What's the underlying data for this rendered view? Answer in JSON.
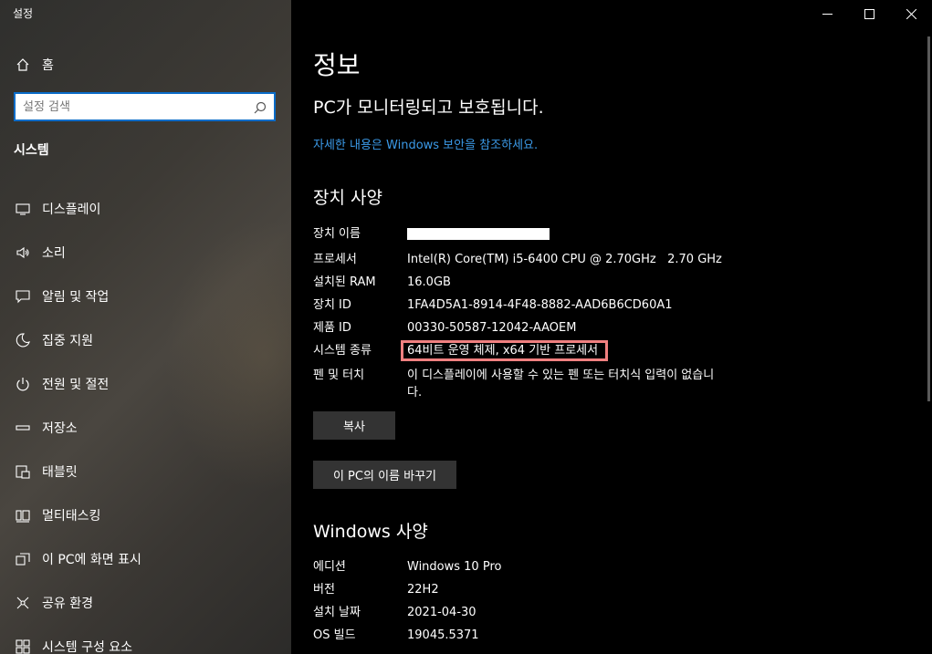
{
  "app": {
    "title": "설정"
  },
  "sidebar": {
    "home_label": "홈",
    "search_placeholder": "설정 검색",
    "section_title": "시스템",
    "items": [
      {
        "label": "디스플레이",
        "icon": "display-icon"
      },
      {
        "label": "소리",
        "icon": "speaker-icon"
      },
      {
        "label": "알림 및 작업",
        "icon": "notification-icon"
      },
      {
        "label": "집중 지원",
        "icon": "moon-icon"
      },
      {
        "label": "전원 및 절전",
        "icon": "power-icon"
      },
      {
        "label": "저장소",
        "icon": "storage-icon"
      },
      {
        "label": "태블릿",
        "icon": "tablet-icon"
      },
      {
        "label": "멀티태스킹",
        "icon": "multitasking-icon"
      },
      {
        "label": "이 PC에 화면 표시",
        "icon": "project-icon"
      },
      {
        "label": "공유 환경",
        "icon": "share-icon"
      },
      {
        "label": "시스템 구성 요소",
        "icon": "components-icon"
      }
    ]
  },
  "main": {
    "page_title": "정보",
    "protect_text": "PC가 모니터링되고 보호됩니다.",
    "security_link": "자세한 내용은 Windows 보안을 참조하세요.",
    "device_specs_title": "장치 사양",
    "device_specs": [
      {
        "key": "장치 이름",
        "value": ""
      },
      {
        "key": "프로세서",
        "value": "Intel(R) Core(TM) i5-6400 CPU @ 2.70GHz   2.70 GHz"
      },
      {
        "key": "설치된 RAM",
        "value": "16.0GB"
      },
      {
        "key": "장치 ID",
        "value": "1FA4D5A1-8914-4F48-8882-AAD6B6CD60A1"
      },
      {
        "key": "제품 ID",
        "value": "00330-50587-12042-AAOEM"
      },
      {
        "key": "시스템 종류",
        "value": "64비트 운영 체제, x64 기반 프로세서"
      },
      {
        "key": "펜 및 터치",
        "value": "이 디스플레이에 사용할 수 있는 펜 또는 터치식 입력이 없습니다."
      }
    ],
    "copy_button": "복사",
    "rename_button": "이 PC의 이름 바꾸기",
    "windows_specs_title": "Windows 사양",
    "windows_specs": [
      {
        "key": "에디션",
        "value": "Windows 10 Pro"
      },
      {
        "key": "버전",
        "value": "22H2"
      },
      {
        "key": "설치 날짜",
        "value": "2021-04-30"
      },
      {
        "key": "OS 빌드",
        "value": "19045.5371"
      }
    ]
  },
  "colors": {
    "accent": "#0a6cc8",
    "link": "#3b9ae8",
    "highlight": "#f08080"
  }
}
